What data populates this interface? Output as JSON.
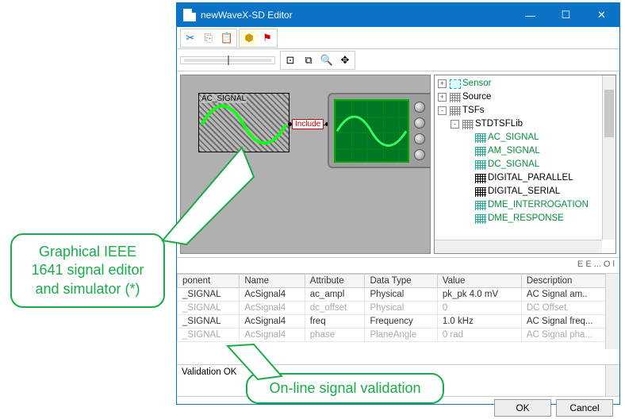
{
  "window": {
    "title": "newWaveX-SD Editor",
    "buttons": {
      "min": "—",
      "max": "☐",
      "close": "✕"
    }
  },
  "toolbar1": {
    "cut": "✂",
    "copy": "⎘",
    "paste": "📋",
    "color": "⬢",
    "flag": "⚑"
  },
  "canvas": {
    "signal_label": "AC_SIGNAL",
    "include_label": "Include"
  },
  "tree": {
    "items": [
      {
        "exp": "+",
        "icon": "sensor",
        "label": "Sensor",
        "cls": "green-text"
      },
      {
        "exp": "+",
        "icon": "gray",
        "label": "Source",
        "cls": ""
      },
      {
        "exp": "-",
        "icon": "gray",
        "label": "TSFs",
        "cls": "",
        "children": [
          {
            "exp": "-",
            "icon": "gray",
            "label": "STDTSFLib",
            "cls": "",
            "children": [
              {
                "icon": "green",
                "label": "AC_SIGNAL",
                "cls": "green-text"
              },
              {
                "icon": "green",
                "label": "AM_SIGNAL",
                "cls": "green-text"
              },
              {
                "icon": "green",
                "label": "DC_SIGNAL",
                "cls": "green-text"
              },
              {
                "icon": "black",
                "label": "DIGITAL_PARALLEL",
                "cls": ""
              },
              {
                "icon": "black",
                "label": "DIGITAL_SERIAL",
                "cls": ""
              },
              {
                "icon": "green",
                "label": "DME_INTERROGATION",
                "cls": "green-text"
              },
              {
                "icon": "green",
                "label": "DME_RESPONSE",
                "cls": "green-text"
              }
            ]
          }
        ]
      }
    ]
  },
  "tabs_fragment": "E       E      ...    O    l",
  "grid": {
    "headers": [
      "ponent",
      "Name",
      "Attribute",
      "Data Type",
      "Value",
      "Description"
    ],
    "rows": [
      {
        "dim": false,
        "cells": [
          "_SIGNAL",
          "AcSignal4",
          "ac_ampl",
          "Physical",
          "pk_pk 4.0 mV",
          "AC Signal am.."
        ]
      },
      {
        "dim": true,
        "cells": [
          "_SIGNAL",
          "AcSignal4",
          "dc_offset",
          "Physical",
          "0",
          "DC Offset."
        ]
      },
      {
        "dim": false,
        "cells": [
          "_SIGNAL",
          "AcSignal4",
          "freq",
          "Frequency",
          "1.0 kHz",
          "AC Signal freq..."
        ]
      },
      {
        "dim": true,
        "cells": [
          "_SIGNAL",
          "AcSignal4",
          "phase",
          "PlaneAngle",
          "0 rad",
          "AC Signal pha..."
        ]
      }
    ]
  },
  "validation": {
    "text": "Validation OK"
  },
  "footer": {
    "ok": "OK",
    "cancel": "Cancel"
  },
  "callouts": {
    "c1": "Graphical IEEE 1641 signal editor and simulator (*)",
    "c2": "On-line signal validation"
  }
}
